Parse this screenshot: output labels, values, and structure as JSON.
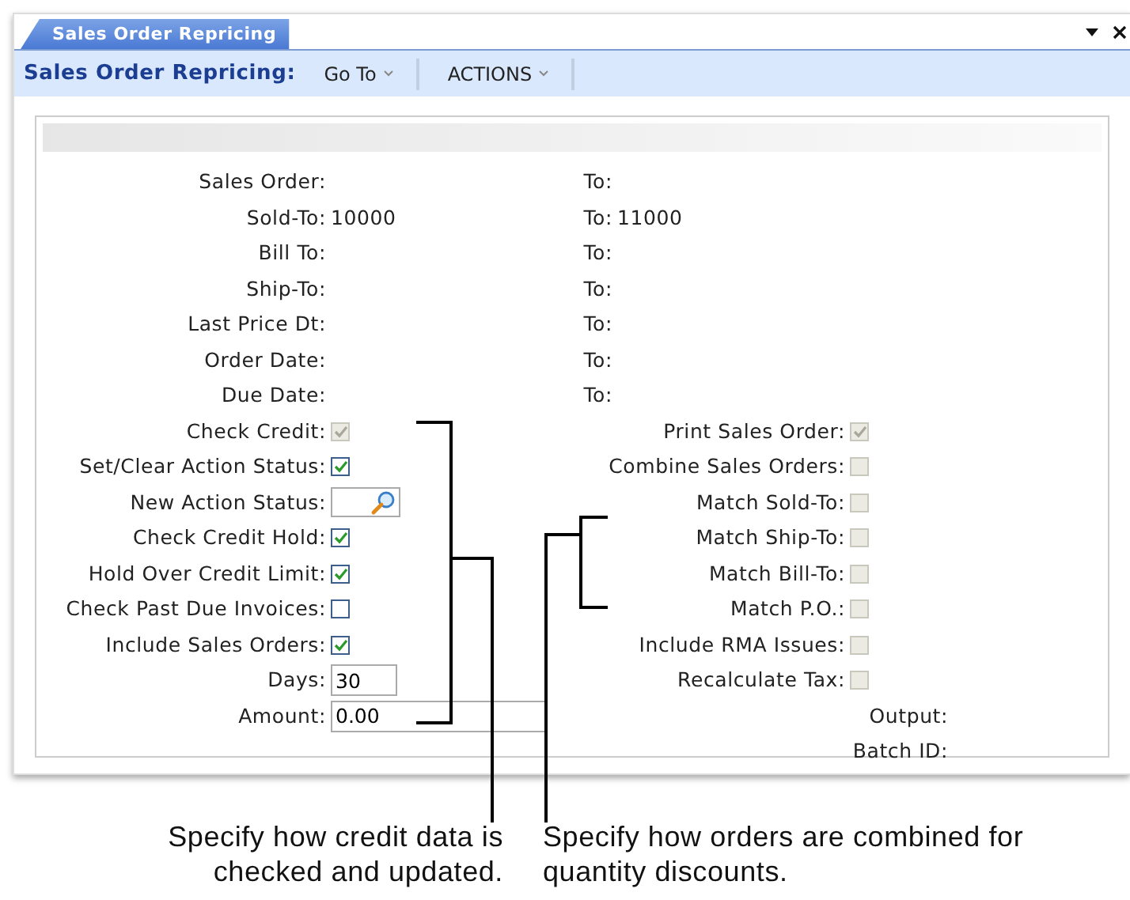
{
  "tab": {
    "label": "Sales Order Repricing",
    "selected": true
  },
  "toolbar": {
    "title": "Sales Order Repricing:",
    "menus": [
      "Go To",
      "ACTIONS"
    ]
  },
  "range_fields": [
    {
      "label": "Sales Order:",
      "to_label": "To:"
    },
    {
      "label": "Sold-To:",
      "value": "10000",
      "to_label": "To:",
      "to_value": "11000"
    },
    {
      "label": "Bill To:",
      "to_label": "To:"
    },
    {
      "label": "Ship-To:",
      "to_label": "To:"
    },
    {
      "label": "Last Price Dt:",
      "to_label": "To:"
    },
    {
      "label": "Order Date:",
      "to_label": "To:"
    },
    {
      "label": "Due Date:",
      "to_label": "To:"
    }
  ],
  "left_options": [
    {
      "kind": "checkbox",
      "label": "Check Credit:",
      "checked": true,
      "disabled": true
    },
    {
      "kind": "checkbox",
      "label": "Set/Clear Action Status:",
      "checked": true,
      "disabled": false
    },
    {
      "kind": "lookup",
      "label": "New Action Status:"
    },
    {
      "kind": "checkbox",
      "label": "Check Credit Hold:",
      "checked": true,
      "disabled": false
    },
    {
      "kind": "checkbox",
      "label": "Hold Over Credit Limit:",
      "checked": true,
      "disabled": false
    },
    {
      "kind": "checkbox",
      "label": "Check Past Due Invoices:",
      "checked": false,
      "disabled": false
    },
    {
      "kind": "checkbox",
      "label": "Include Sales Orders:",
      "checked": true,
      "disabled": false
    },
    {
      "kind": "short_input",
      "label": "Days:",
      "value": "30"
    },
    {
      "kind": "long_input",
      "label": "Amount:",
      "value": "0.00"
    }
  ],
  "right_options": [
    {
      "kind": "checkbox",
      "label": "Print Sales Order:",
      "checked": true,
      "disabled": true
    },
    {
      "kind": "checkbox",
      "label": "Combine Sales Orders:",
      "checked": false,
      "disabled": true
    },
    {
      "kind": "checkbox",
      "label": "Match Sold-To:",
      "checked": false,
      "disabled": true
    },
    {
      "kind": "checkbox",
      "label": "Match Ship-To:",
      "checked": false,
      "disabled": true
    },
    {
      "kind": "checkbox",
      "label": "Match Bill-To:",
      "checked": false,
      "disabled": true
    },
    {
      "kind": "checkbox",
      "label": "Match P.O.:",
      "checked": false,
      "disabled": true
    },
    {
      "kind": "checkbox",
      "label": "Include RMA Issues:",
      "checked": false,
      "disabled": true
    },
    {
      "kind": "checkbox",
      "label": "Recalculate Tax:",
      "checked": false,
      "disabled": true
    },
    {
      "kind": "text",
      "label": "Output:"
    },
    {
      "kind": "text",
      "label": "Batch ID:"
    }
  ],
  "callouts": [
    "Specify how credit data is checked and updated.",
    "Specify how orders are combined for quantity discounts."
  ]
}
